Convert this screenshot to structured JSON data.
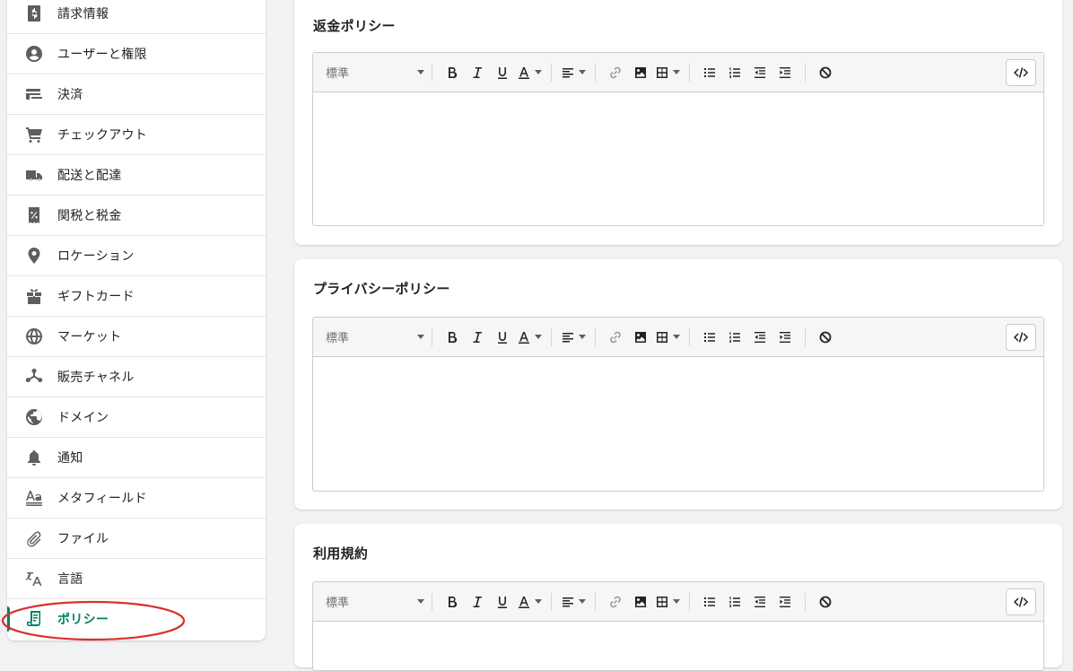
{
  "sidebar": {
    "items": [
      {
        "label": "請求情報",
        "icon": "billing-icon"
      },
      {
        "label": "ユーザーと権限",
        "icon": "user-icon"
      },
      {
        "label": "決済",
        "icon": "payment-icon"
      },
      {
        "label": "チェックアウト",
        "icon": "cart-icon"
      },
      {
        "label": "配送と配達",
        "icon": "truck-icon"
      },
      {
        "label": "関税と税金",
        "icon": "tax-icon"
      },
      {
        "label": "ロケーション",
        "icon": "location-icon"
      },
      {
        "label": "ギフトカード",
        "icon": "gift-icon"
      },
      {
        "label": "マーケット",
        "icon": "globe-icon"
      },
      {
        "label": "販売チャネル",
        "icon": "channels-icon"
      },
      {
        "label": "ドメイン",
        "icon": "domain-icon"
      },
      {
        "label": "通知",
        "icon": "bell-icon"
      },
      {
        "label": "メタフィールド",
        "icon": "metafield-icon"
      },
      {
        "label": "ファイル",
        "icon": "paperclip-icon"
      },
      {
        "label": "言語",
        "icon": "language-icon"
      },
      {
        "label": "ポリシー",
        "icon": "policy-icon",
        "active": true
      }
    ]
  },
  "editor_toolbar": {
    "format_value": "標準"
  },
  "sections": [
    {
      "title": "返金ポリシー"
    },
    {
      "title": "プライバシーポリシー"
    },
    {
      "title": "利用規約"
    }
  ],
  "colors": {
    "accent": "#008060",
    "annotation": "#d9302c"
  }
}
